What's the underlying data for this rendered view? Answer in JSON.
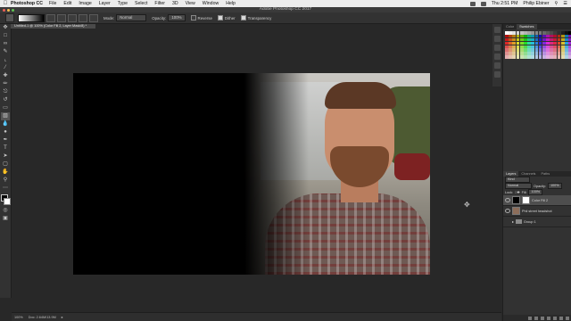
{
  "menubar": {
    "app_name": "Photoshop CC",
    "items": [
      "File",
      "Edit",
      "Image",
      "Layer",
      "Type",
      "Select",
      "Filter",
      "3D",
      "View",
      "Window",
      "Help"
    ],
    "clock": "Thu 2:51 PM",
    "user": "Philip Ebiner"
  },
  "window": {
    "title": "Adobe Photoshop CC 2017"
  },
  "options_bar": {
    "mode_label": "Mode:",
    "mode_value": "Normal",
    "opacity_label": "Opacity:",
    "opacity_value": "100%",
    "reverse_label": "Reverse",
    "dither_label": "Dither",
    "transparency_label": "Transparency",
    "reverse_checked": false,
    "dither_checked": true,
    "transparency_checked": true
  },
  "document": {
    "tab_label": "Untitled-1 @ 100% (Color Fill 2, Layer Mask/8) *"
  },
  "status_bar": {
    "zoom": "100%",
    "doc_info": "Doc: 2.64M/13.9M"
  },
  "tools": [
    "move",
    "marquee",
    "lasso",
    "quick-select",
    "crop",
    "eyedropper",
    "healing",
    "brush",
    "stamp",
    "history-brush",
    "eraser",
    "gradient",
    "blur",
    "dodge",
    "pen",
    "type",
    "path-select",
    "rectangle",
    "hand",
    "zoom"
  ],
  "color_panel": {
    "tabs": [
      "Color",
      "Swatches"
    ],
    "active_tab": "Swatches"
  },
  "layers_panel": {
    "tabs": [
      "Layers",
      "Channels",
      "Paths"
    ],
    "active_tab": "Layers",
    "filter_label": "Kind",
    "blend_mode": "Normal",
    "opacity_label": "Opacity:",
    "opacity_value": "100%",
    "lock_label": "Lock:",
    "fill_label": "Fill:",
    "fill_value": "100%",
    "layers": [
      {
        "name": "Color Fill 2",
        "selected": true,
        "type": "fill"
      },
      {
        "name": "Phil street headshot",
        "selected": false,
        "type": "photo"
      },
      {
        "name": "Group 1",
        "selected": false,
        "type": "group"
      }
    ]
  },
  "colors": {
    "ui_dark": "#323232",
    "canvas_bg": "#282828",
    "menubar_bg": "#ececec",
    "selection": "#4e4e4e"
  }
}
